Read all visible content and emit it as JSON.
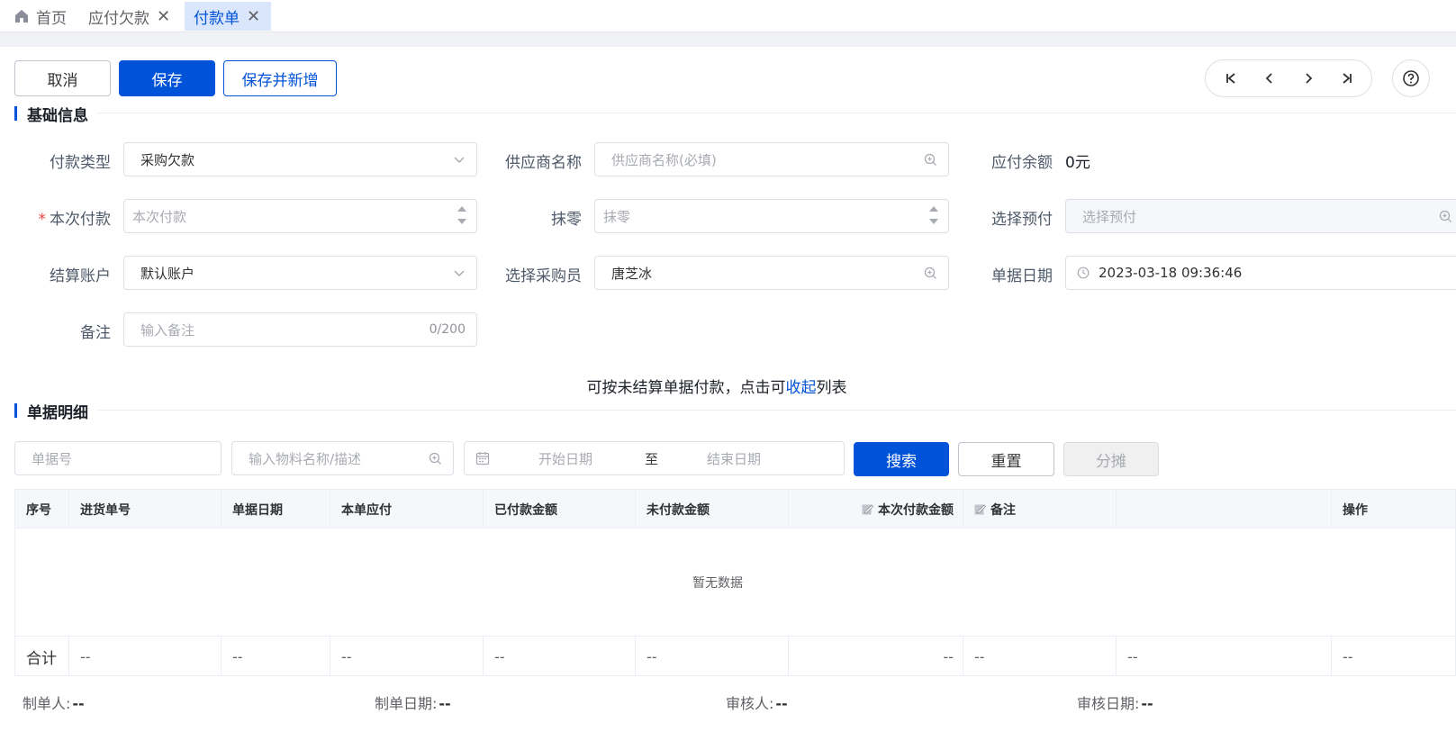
{
  "tabs": [
    {
      "label": "首页",
      "icon": "home-icon",
      "closable": false,
      "active": false
    },
    {
      "label": "应付欠款",
      "closable": true,
      "active": false
    },
    {
      "label": "付款单",
      "closable": true,
      "active": true
    }
  ],
  "toolbar": {
    "cancel_label": "取消",
    "save_label": "保存",
    "save_new_label": "保存并新增"
  },
  "pager": {
    "icons": [
      "first-page-icon",
      "prev-page-icon",
      "next-page-icon",
      "last-page-icon"
    ]
  },
  "basic_section": {
    "title": "基础信息",
    "payment_type": {
      "label": "付款类型",
      "value": "采购欠款"
    },
    "supplier": {
      "label": "供应商名称",
      "placeholder": "供应商名称(必填)"
    },
    "payable_balance": {
      "label": "应付余额",
      "value": "0元"
    },
    "this_payment": {
      "required_mark": "*",
      "label": "本次付款",
      "placeholder": "本次付款"
    },
    "rounding": {
      "label": "抹零",
      "placeholder": "抹零"
    },
    "select_prepay": {
      "label": "选择预付",
      "placeholder": "选择预付"
    },
    "account": {
      "label": "结算账户",
      "value": "默认账户"
    },
    "buyer": {
      "label": "选择采购员",
      "value": "唐芝冰"
    },
    "doc_date": {
      "label": "单据日期",
      "value": "2023-03-18 09:36:46"
    },
    "remark": {
      "label": "备注",
      "placeholder": "输入备注",
      "counter": "0/200"
    }
  },
  "hint": {
    "before": "可按未结算单据付款，点击可",
    "link": "收起",
    "after": "列表"
  },
  "detail_section": {
    "title": "单据明细",
    "doc_no_placeholder": "单据号",
    "material_placeholder": "输入物料名称/描述",
    "start_date_placeholder": "开始日期",
    "range_sep": "至",
    "end_date_placeholder": "结束日期",
    "search_label": "搜索",
    "reset_label": "重置",
    "split_label": "分摊"
  },
  "table": {
    "headers": [
      "序号",
      "进货单号",
      "单据日期",
      "本单应付",
      "已付款金额",
      "未付款金额",
      "本次付款金额",
      "备注",
      "",
      "操作"
    ],
    "empty_text": "暂无数据",
    "footer": [
      "合计",
      "--",
      "--",
      "--",
      "--",
      "--",
      "--",
      "--",
      "--",
      "--"
    ]
  },
  "meta": {
    "creator_label": "制单人:",
    "creator": "--",
    "created_label": "制单日期:",
    "created": "--",
    "auditor_label": "审核人:",
    "auditor": "--",
    "audited_label": "审核日期:",
    "audited": "--"
  }
}
